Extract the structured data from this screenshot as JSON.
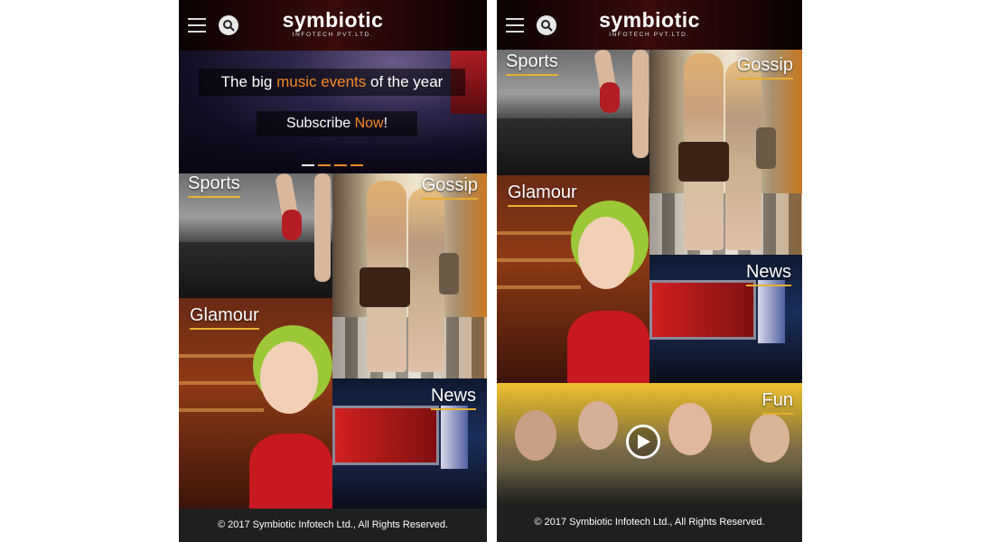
{
  "screens": [
    {
      "header": {
        "logo_main": "symbiotic",
        "logo_sub": "INFOTECH PVT.LTD."
      },
      "slider": {
        "line1_a": "The big ",
        "line1_highlight": "music events",
        "line1_b": " of the year",
        "line2_a": "Subscribe ",
        "line2_highlight": "Now",
        "line2_b": "!",
        "dots_count": 4,
        "active_dot": 1
      },
      "tiles": {
        "sports": "Sports",
        "gossip": "Gossip",
        "glamour": "Glamour",
        "news": "News"
      },
      "footer": "© 2017 Symbiotic Infotech Ltd., All Rights Reserved."
    },
    {
      "header": {
        "logo_main": "symbiotic",
        "logo_sub": "INFOTECH PVT.LTD."
      },
      "tiles": {
        "sports": "Sports",
        "gossip": "Gossip",
        "glamour": "Glamour",
        "news": "News",
        "fun": "Fun"
      },
      "footer": "© 2017 Symbiotic Infotech Ltd., All Rights Reserved."
    }
  ],
  "colors": {
    "accent_orange": "#f58a1f",
    "label_underline": "#e6b030",
    "header_bg": "#2a0808",
    "footer_bg": "#1f1f1f"
  },
  "icons": [
    "hamburger-menu-icon",
    "search-icon",
    "play-icon"
  ]
}
